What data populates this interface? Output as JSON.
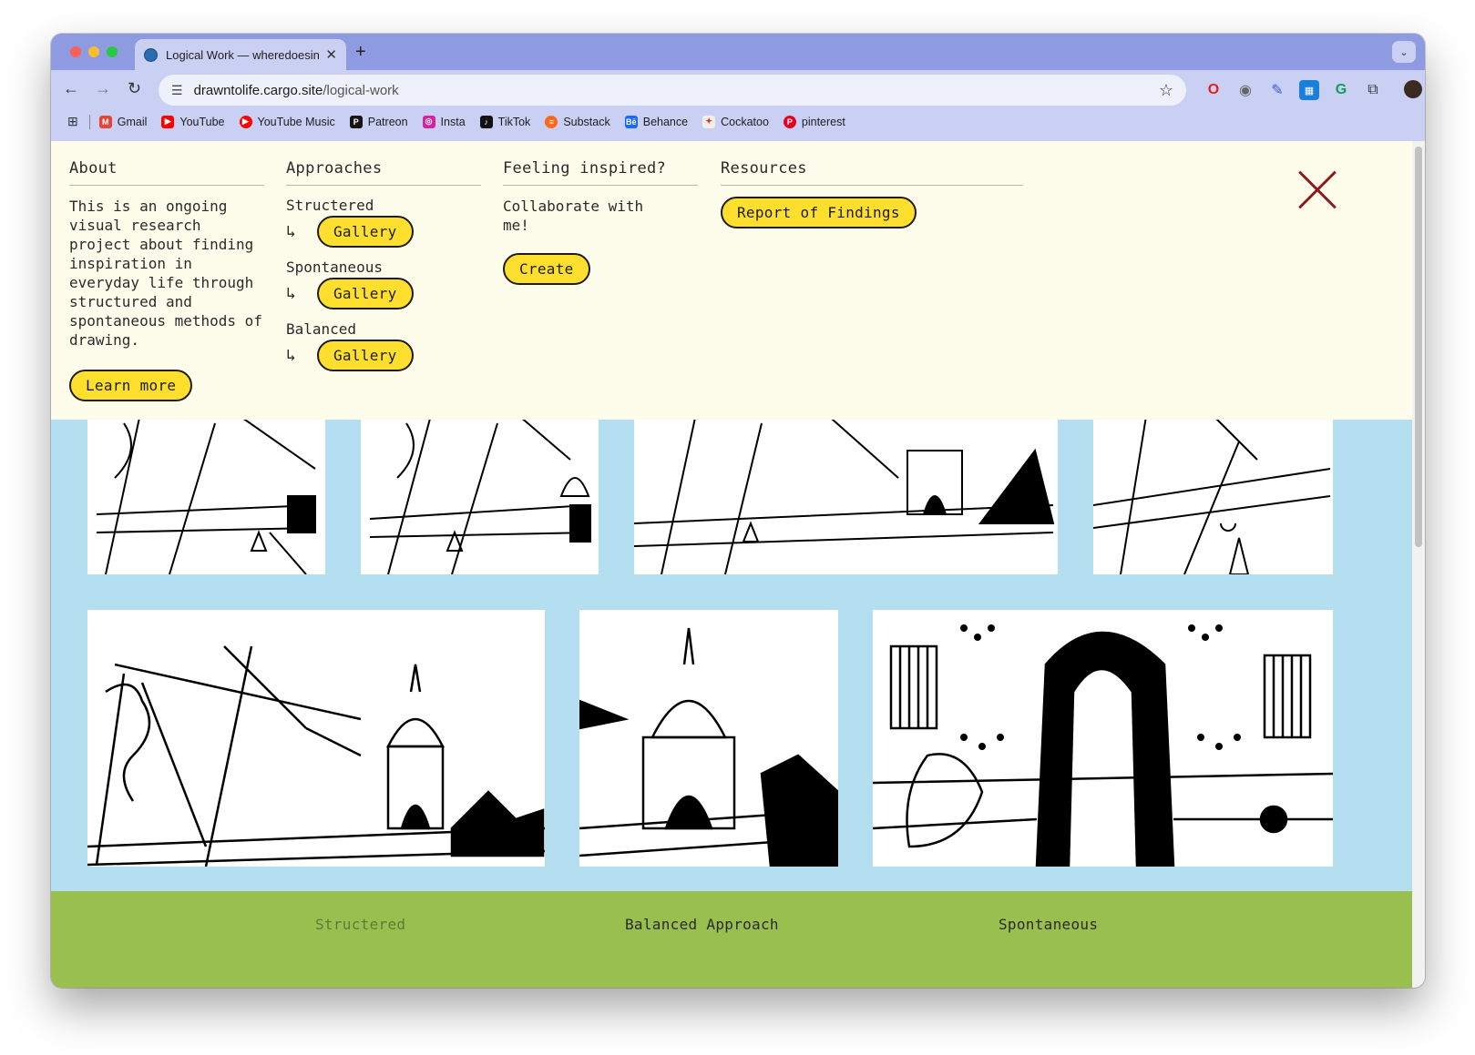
{
  "browser": {
    "tab_title": "Logical Work — wheredoesins",
    "url_domain": "drawntolife.cargo.site",
    "url_path": "/logical-work",
    "bookmarks": [
      "Gmail",
      "YouTube",
      "YouTube Music",
      "Patreon",
      "Insta",
      "TikTok",
      "Substack",
      "Behance",
      "Cockatoo",
      "pinterest"
    ]
  },
  "menu": {
    "about": {
      "heading": "About",
      "text": "This is an ongoing visual research project about finding inspiration in everyday life through structured and spontaneous methods of drawing.",
      "button": "Learn more"
    },
    "approaches": {
      "heading": "Approaches",
      "items": [
        {
          "label": "Structered",
          "button": "Gallery"
        },
        {
          "label": "Spontaneous",
          "button": "Gallery"
        },
        {
          "label": "Balanced",
          "button": "Gallery"
        }
      ]
    },
    "inspired": {
      "heading": "Feeling inspired?",
      "text": "Collaborate with me!",
      "button": "Create"
    },
    "resources": {
      "heading": "Resources",
      "button": "Report of Findings"
    }
  },
  "footer": {
    "structured": "Structered",
    "balanced": "Balanced Approach",
    "spontaneous": "Spontaneous"
  },
  "colors": {
    "page_bg": "#b3dff0",
    "menu_bg": "#fefdec",
    "pill": "#ffdf2e",
    "footer_bg": "#99bf4f",
    "close": "#8c1c1c"
  }
}
